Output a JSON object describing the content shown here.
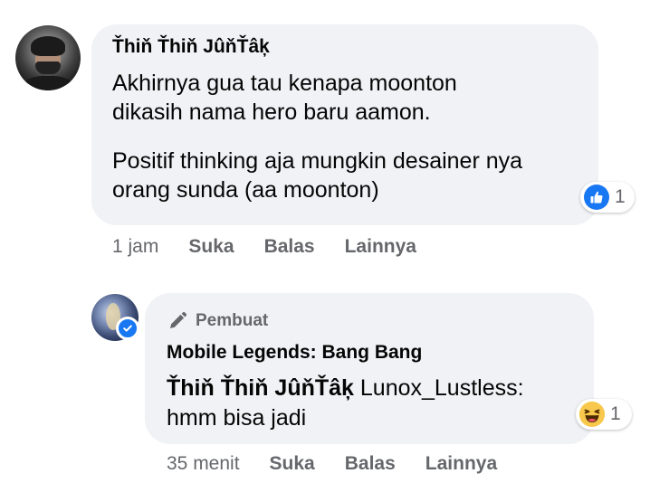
{
  "comment": {
    "author": "Ťhiň Ťhiň JûňŤâķ",
    "lines": [
      "Akhirnya gua tau kenapa moonton",
      "dikasih nama hero baru aamon.",
      "Positif thinking aja mungkin desainer nya",
      "orang sunda (aa moonton)"
    ],
    "reaction": {
      "icon": "like-icon",
      "count": "1"
    },
    "time": "1 jam",
    "actions": {
      "like": "Suka",
      "reply": "Balas",
      "more": "Lainnya"
    }
  },
  "reply": {
    "badge": "Pembuat",
    "author": "Mobile Legends: Bang Bang",
    "mention": "Ťhiň Ťhiň JûňŤâķ",
    "text_after_mention": " Lunox_Lustless:",
    "text_line2": "hmm bisa jadi",
    "reaction": {
      "icon": "haha-icon",
      "count": "1"
    },
    "time": "35 menit",
    "actions": {
      "like": "Suka",
      "reply": "Balas",
      "more": "Lainnya"
    }
  },
  "colors": {
    "bubble": "#f0f2f5",
    "text": "#050505",
    "secondary": "#65676b",
    "accent": "#1877f2"
  }
}
